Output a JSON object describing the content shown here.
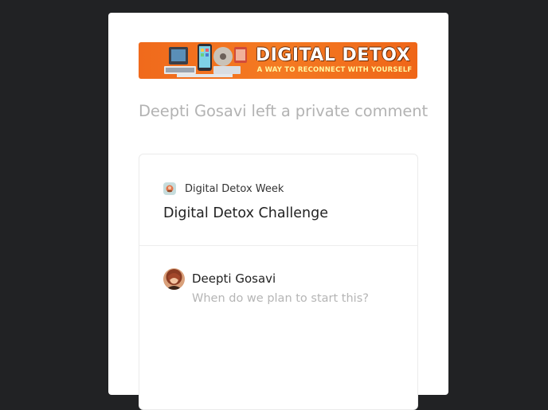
{
  "banner": {
    "title": "DIGITAL DETOX",
    "subtitle": "A WAY TO RECONNECT WITH YOURSELF"
  },
  "headline": "Deepti Gosavi left a private comment",
  "card": {
    "source_name": "Digital Detox Week",
    "title": "Digital Detox Challenge"
  },
  "comment": {
    "author": "Deepti Gosavi",
    "text": "When do we plan to start this?"
  },
  "colors": {
    "page_background": "#212224",
    "banner_orange": "#f47a22",
    "muted_text": "#b3b3b3"
  },
  "icons": {
    "source": "digital-detox-week-icon",
    "avatar": "user-avatar"
  }
}
